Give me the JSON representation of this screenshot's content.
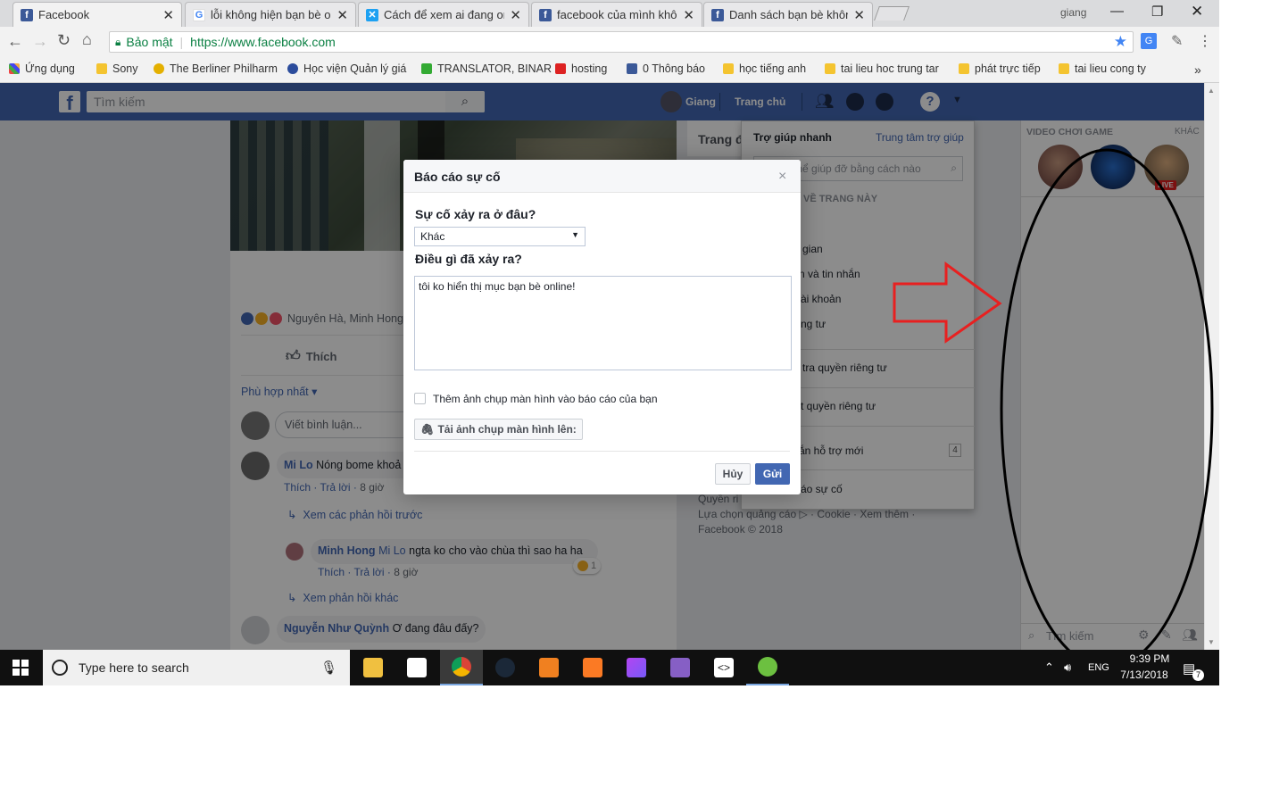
{
  "browser": {
    "tabs": [
      {
        "title": "Facebook",
        "favicon": "facebook-icon"
      },
      {
        "title": "lỗi không hiện bạn bè on",
        "favicon": "google-icon"
      },
      {
        "title": "Cách để xem ai đang onl",
        "favicon": "site-icon"
      },
      {
        "title": "facebook của mình không",
        "favicon": "facebook-icon"
      },
      {
        "title": "Danh sách bạn bè không",
        "favicon": "facebook-icon"
      }
    ],
    "window_user": "giang",
    "secure_label": "Bảo mật",
    "url": "https://www.facebook.com",
    "bookmarks": [
      "Ứng dụng",
      "Sony",
      "The Berliner Philharm",
      "Học viện Quản lý giá",
      "TRANSLATOR, BINAR",
      "hosting",
      "0 Thông báo",
      "học tiếng anh",
      "tai lieu hoc trung tar",
      "phát trực tiếp",
      "tai lieu cong ty"
    ]
  },
  "fb_header": {
    "search_placeholder": "Tìm kiếm",
    "user_name": "Giang",
    "home_label": "Trang chủ"
  },
  "post": {
    "reactions_text": "Nguyên Hà, Minh Hong",
    "like_label": "Thích",
    "sort_label": "Phù hợp nhất",
    "comment_placeholder": "Viết bình luận...",
    "comments": [
      {
        "name": "Mi Lo",
        "text": "Nóng bome khoả",
        "like": "Thích",
        "reply": "Trả lời",
        "time": "8 giờ"
      },
      {
        "name": "Minh Hong",
        "tag": "Mi Lo",
        "text": "ngta ko cho vào chùa thì sao ha ha",
        "like": "Thích",
        "reply": "Trả lời",
        "time": "8 giờ",
        "reaction_count": "1"
      },
      {
        "name": "Nguyễn Như Quỳnh",
        "text": "Ơ đang đâu đấy?"
      }
    ],
    "view_prev_replies": "Xem các phản hồi trước",
    "view_more_replies": "Xem phản hồi khác"
  },
  "right_column": {
    "partial_title": "Trang đ",
    "footer_line1": "Quyền ri",
    "footer_line2": "Lựa chọn quảng cáo ▷ · Cookie · Xem thêm ·",
    "copyright": "Facebook © 2018"
  },
  "help_menu": {
    "title": "Trợ giúp nhanh",
    "center_link": "Trung tâm trợ giúp",
    "search_placeholder": "Tôi có thể giúp đỡ bằng cách nào",
    "section": "VỀ TRANG NÀY",
    "items": [
      "gian",
      "n và tin nhắn",
      "ài khoản",
      "ng tư"
    ],
    "privacy_check": "tra quyền riêng tư",
    "privacy_shortcut": "t quyền riêng tư",
    "support_inbox": "ắn hỗ trợ mới",
    "support_count": "4",
    "report": "áo sự cố"
  },
  "chat_sidebar": {
    "video_title": "VIDEO CHƠI GAME",
    "more": "KHÁC",
    "live_badge": "LIVE",
    "search_placeholder": "Tìm kiếm"
  },
  "report_dialog": {
    "title": "Báo cáo sự cố",
    "where_label": "Sự cố xảy ra ở đâu?",
    "where_value": "Khác",
    "what_label": "Điều gì đã xảy ra?",
    "description": "tôi ko hiển thị mục bạn bè online!",
    "screenshot_checkbox_label": "Thêm ảnh chụp màn hình vào báo cáo của bạn",
    "upload_label": "Tải ảnh chụp màn hình lên:",
    "cancel_label": "Hủy",
    "send_label": "Gửi"
  },
  "taskbar": {
    "search_placeholder": "Type here to search",
    "lang": "ENG",
    "time": "9:39 PM",
    "date": "7/13/2018",
    "notification_count": "7"
  },
  "colors": {
    "fb_blue": "#4267b2",
    "annotation_red": "#e82020",
    "annotation_black": "#000000"
  }
}
